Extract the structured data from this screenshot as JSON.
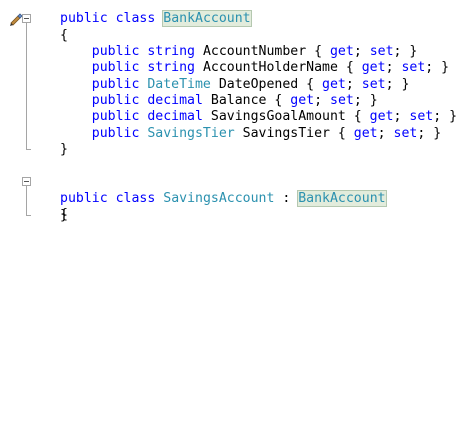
{
  "editor": {
    "lines": [
      {
        "indent": "",
        "tokens": [
          {
            "t": "public",
            "c": "kw"
          },
          {
            "t": " "
          },
          {
            "t": "class",
            "c": "kw"
          },
          {
            "t": " "
          },
          {
            "t": "BankAccount",
            "c": "ty hl"
          }
        ]
      },
      {
        "indent": "",
        "tokens": [
          {
            "t": "{"
          }
        ]
      },
      {
        "indent": "    ",
        "tokens": [
          {
            "t": "public",
            "c": "kw"
          },
          {
            "t": " "
          },
          {
            "t": "string",
            "c": "kw"
          },
          {
            "t": " AccountNumber { "
          },
          {
            "t": "get",
            "c": "kw"
          },
          {
            "t": "; "
          },
          {
            "t": "set",
            "c": "kw"
          },
          {
            "t": "; }"
          }
        ]
      },
      {
        "indent": "    ",
        "tokens": [
          {
            "t": "public",
            "c": "kw"
          },
          {
            "t": " "
          },
          {
            "t": "string",
            "c": "kw"
          },
          {
            "t": " AccountHolderName { "
          },
          {
            "t": "get",
            "c": "kw"
          },
          {
            "t": "; "
          },
          {
            "t": "set",
            "c": "kw"
          },
          {
            "t": "; }"
          }
        ]
      },
      {
        "indent": "    ",
        "tokens": [
          {
            "t": "public",
            "c": "kw"
          },
          {
            "t": " "
          },
          {
            "t": "DateTime",
            "c": "ty"
          },
          {
            "t": " DateOpened { "
          },
          {
            "t": "get",
            "c": "kw"
          },
          {
            "t": "; "
          },
          {
            "t": "set",
            "c": "kw"
          },
          {
            "t": "; }"
          }
        ]
      },
      {
        "indent": "    ",
        "tokens": [
          {
            "t": "public",
            "c": "kw"
          },
          {
            "t": " "
          },
          {
            "t": "decimal",
            "c": "kw"
          },
          {
            "t": " Balance { "
          },
          {
            "t": "get",
            "c": "kw"
          },
          {
            "t": "; "
          },
          {
            "t": "set",
            "c": "kw"
          },
          {
            "t": "; }"
          }
        ]
      },
      {
        "indent": "    ",
        "tokens": [
          {
            "t": "public",
            "c": "kw"
          },
          {
            "t": " "
          },
          {
            "t": "decimal",
            "c": "kw"
          },
          {
            "t": " SavingsGoalAmount { "
          },
          {
            "t": "get",
            "c": "kw"
          },
          {
            "t": "; "
          },
          {
            "t": "set",
            "c": "kw"
          },
          {
            "t": "; }"
          }
        ]
      },
      {
        "indent": "    ",
        "tokens": [
          {
            "t": "public",
            "c": "kw"
          },
          {
            "t": " "
          },
          {
            "t": "SavingsTier",
            "c": "ty"
          },
          {
            "t": " SavingsTier { "
          },
          {
            "t": "get",
            "c": "kw"
          },
          {
            "t": "; "
          },
          {
            "t": "set",
            "c": "kw"
          },
          {
            "t": "; }"
          }
        ]
      },
      {
        "indent": "",
        "tokens": [
          {
            "t": "}"
          }
        ]
      },
      {
        "indent": "",
        "tokens": []
      },
      {
        "indent": "",
        "tokens": [
          {
            "t": "public",
            "c": "kw"
          },
          {
            "t": " "
          },
          {
            "t": "class",
            "c": "kw"
          },
          {
            "t": " "
          },
          {
            "t": "SavingsAccount",
            "c": "ty"
          },
          {
            "t": " : "
          },
          {
            "t": "BankAccount",
            "c": "ty hl"
          }
        ]
      },
      {
        "indent": "",
        "tokens": [
          {
            "t": "{"
          }
        ]
      },
      {
        "indent": "",
        "tokens": [
          {
            "t": "}"
          }
        ]
      }
    ]
  },
  "colors": {
    "keyword": "#0000ff",
    "type": "#2b91af",
    "highlight": "#e2ecdc",
    "background": "#ffffff"
  },
  "gutter": {
    "icons": [
      "edit-icon",
      "collapse-icon",
      "collapse-icon"
    ]
  }
}
